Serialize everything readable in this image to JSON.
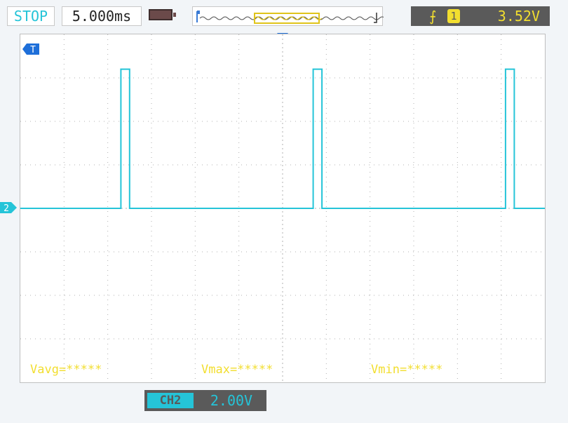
{
  "status": {
    "run_state": "STOP"
  },
  "timebase": {
    "value": "5.000ms"
  },
  "trigger": {
    "edge_symbol": "⨍",
    "source": "1",
    "level": "3.52V"
  },
  "markers": {
    "trigger_marker": "T",
    "channel_marker": "2"
  },
  "measurements": {
    "vavg": "Vavg=*****",
    "vmax": "Vmax=*****",
    "vmin": "Vmin=*****"
  },
  "channel": {
    "label": "CH2",
    "scale": "2.00V",
    "coupling_symbol": "═══"
  },
  "colors": {
    "trace": "#25c4d8",
    "measurement_text": "#f2de2f",
    "grid": "#b0b0b0"
  },
  "chart_data": {
    "type": "line",
    "series": [
      {
        "x": [
          0,
          2.3,
          2.3,
          2.5,
          2.5,
          6.7,
          6.7,
          6.9,
          6.9,
          11.1,
          11.1,
          11.3,
          11.3,
          12
        ],
        "y": [
          0,
          0,
          3.2,
          3.2,
          0,
          0,
          3.2,
          3.2,
          0,
          0,
          3.2,
          3.2,
          0,
          0
        ]
      }
    ],
    "xlim": [
      0,
      12
    ],
    "ylim": [
      -4,
      4
    ],
    "grid": true
  }
}
